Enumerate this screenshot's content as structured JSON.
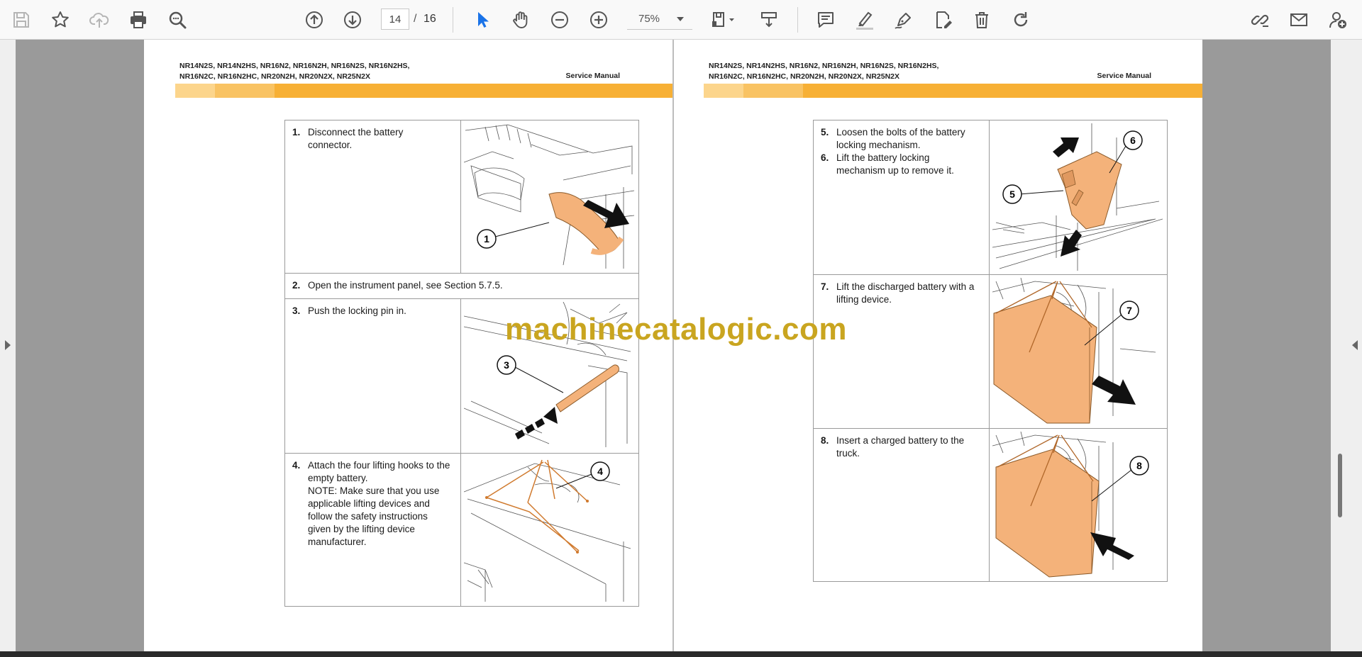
{
  "toolbar": {
    "tools": [
      {
        "id": "save",
        "icon": "save-icon"
      },
      {
        "id": "bookmark",
        "icon": "star-icon"
      },
      {
        "id": "upload",
        "icon": "cloud-upload-icon"
      },
      {
        "id": "print",
        "icon": "printer-icon"
      },
      {
        "id": "find",
        "icon": "find-zoom-icon"
      },
      {
        "id": "prev",
        "icon": "arrow-up-circle-icon"
      },
      {
        "id": "next",
        "icon": "arrow-down-circle-icon"
      },
      {
        "id": "select",
        "icon": "pointer-icon"
      },
      {
        "id": "pan",
        "icon": "hand-icon"
      },
      {
        "id": "zoom-out",
        "icon": "minus-circle-icon"
      },
      {
        "id": "zoom-in",
        "icon": "plus-circle-icon"
      },
      {
        "id": "page-fit",
        "icon": "page-fit-icon"
      },
      {
        "id": "scroll-mode",
        "icon": "scroll-mode-icon"
      },
      {
        "id": "comment",
        "icon": "comment-icon"
      },
      {
        "id": "highlight",
        "icon": "highlighter-icon"
      },
      {
        "id": "sign",
        "icon": "pen-nib-icon"
      },
      {
        "id": "edit",
        "icon": "edit-file-icon"
      },
      {
        "id": "delete",
        "icon": "trash-icon"
      },
      {
        "id": "rotate",
        "icon": "rotate-icon"
      },
      {
        "id": "link",
        "icon": "link-icon"
      },
      {
        "id": "email",
        "icon": "email-icon"
      },
      {
        "id": "add-user",
        "icon": "add-user-icon"
      }
    ],
    "page_current": "14",
    "page_separator": "/",
    "page_total": "16",
    "zoom": "75%"
  },
  "document": {
    "header_models_line1": "NR14N2S, NR14N2HS, NR16N2, NR16N2H, NR16N2S, NR16N2HS,",
    "header_models_line2": "NR16N2C, NR16N2HC, NR20N2H, NR20N2X, NR25N2X",
    "header_title": "Service Manual",
    "watermark": "machinecatalogic.com"
  },
  "left_steps": [
    {
      "num": "1.",
      "lines": [
        "Disconnect the battery",
        "connector."
      ],
      "callout": "1"
    },
    {
      "num": "2.",
      "lines": [
        "Open the instrument panel, see Section 5.7.5."
      ],
      "callout": ""
    },
    {
      "num": "3.",
      "lines": [
        "Push the locking pin in."
      ],
      "callout": "3"
    },
    {
      "num": "4.",
      "lines": [
        "Attach the four lifting hooks to the",
        "empty battery.",
        "NOTE: Make sure that you use",
        "applicable lifting devices and",
        "follow the safety instructions",
        "given by the lifting device",
        "manufacturer."
      ],
      "callout": "4"
    }
  ],
  "right_steps": [
    {
      "items": [
        {
          "num": "5.",
          "lines": [
            "Loosen the bolts of the battery",
            "locking mechanism."
          ]
        },
        {
          "num": "6.",
          "lines": [
            "Lift the battery locking",
            "mechanism up to remove it."
          ]
        }
      ],
      "callouts": [
        "5",
        "6"
      ]
    },
    {
      "items": [
        {
          "num": "7.",
          "lines": [
            "Lift the discharged battery with a",
            "lifting device."
          ]
        }
      ],
      "callouts": [
        "7"
      ]
    },
    {
      "items": [
        {
          "num": "8.",
          "lines": [
            "Insert a charged battery to the",
            "truck."
          ]
        }
      ],
      "callouts": [
        "8"
      ]
    }
  ],
  "colors": {
    "accent_band": "#f7b035",
    "part_highlight": "#f4b27a",
    "watermark": "#c9a520"
  }
}
